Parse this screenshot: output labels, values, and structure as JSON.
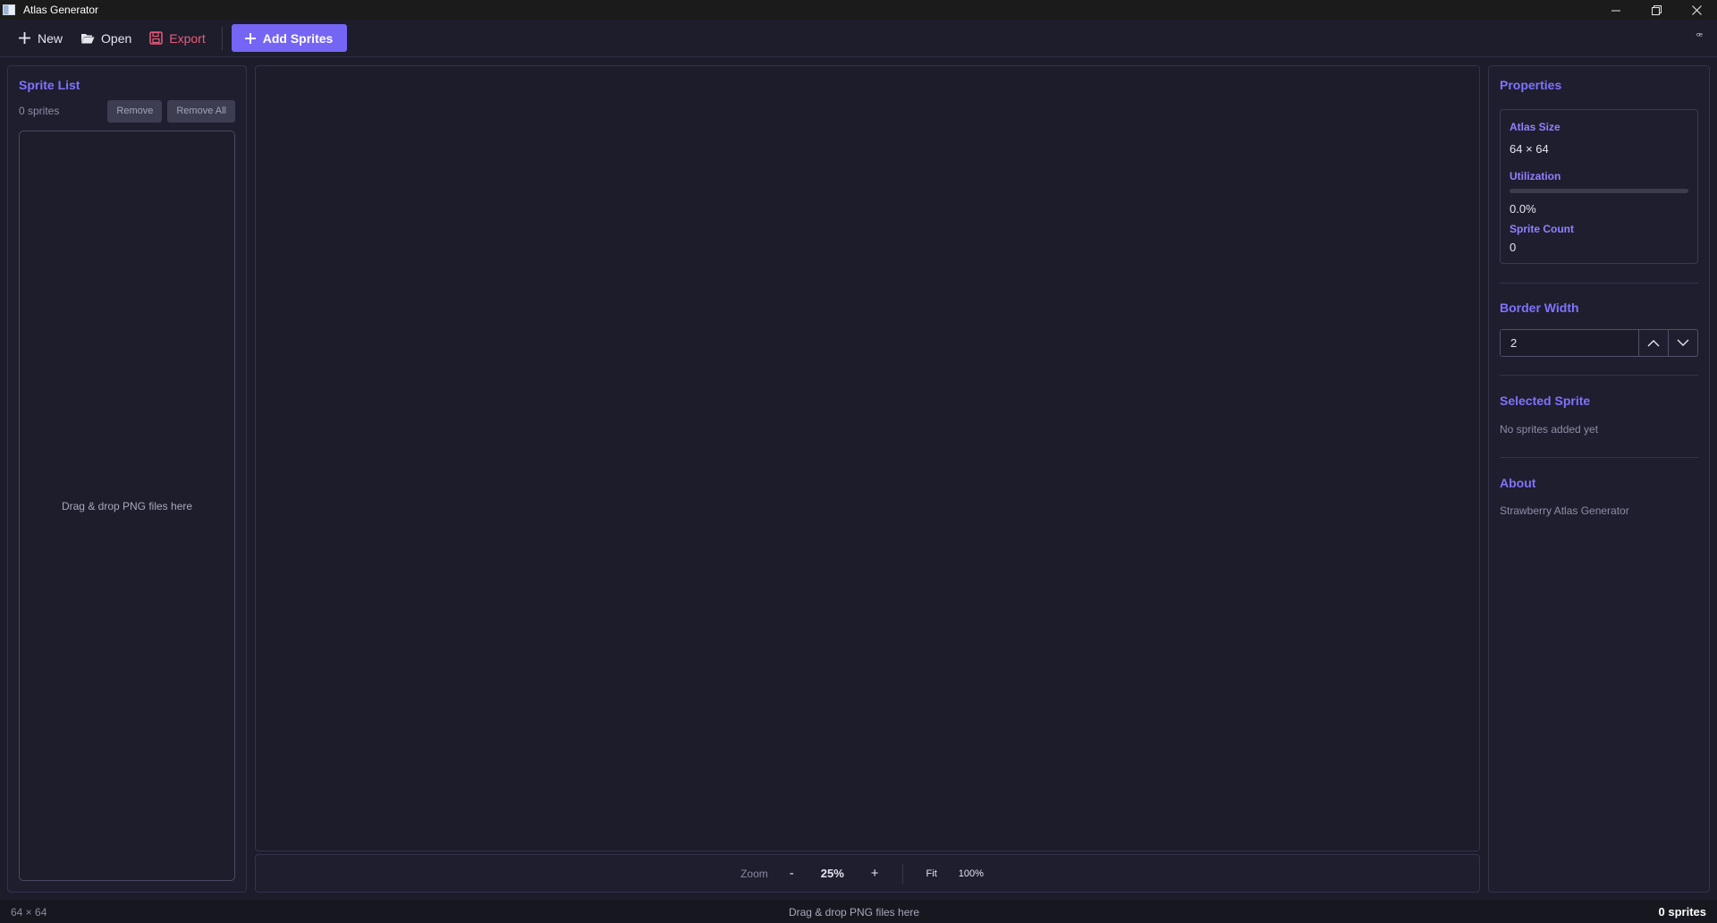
{
  "window": {
    "title": "Atlas Generator",
    "minimize_icon": "minimize-icon",
    "maximize_icon": "restore-icon",
    "close_icon": "close-icon"
  },
  "toolbar": {
    "new_label": "New",
    "open_label": "Open",
    "export_label": "Export",
    "add_sprites_label": "Add Sprites",
    "right_glyph": "ꟹ"
  },
  "sprite_list": {
    "title": "Sprite List",
    "count_text": "0 sprites",
    "remove_label": "Remove",
    "remove_all_label": "Remove All",
    "drop_text": "Drag & drop PNG files here"
  },
  "zoom": {
    "label": "Zoom",
    "minus": "-",
    "value": "25%",
    "plus": "+",
    "fit_label": "Fit",
    "actual_label": "100%"
  },
  "properties": {
    "title": "Properties",
    "atlas_size_label": "Atlas Size",
    "atlas_size_value": "64 × 64",
    "utilization_label": "Utilization",
    "utilization_fraction": 0.0,
    "utilization_value": "0.0%",
    "sprite_count_label": "Sprite Count",
    "sprite_count_value": "0",
    "border_width_title": "Border Width",
    "border_width_value": "2",
    "selected_sprite_title": "Selected Sprite",
    "selected_sprite_text": "No sprites added yet",
    "about_title": "About",
    "about_text": "Strawberry Atlas Generator"
  },
  "statusbar": {
    "left": "64 × 64",
    "center": "Drag & drop PNG files here",
    "right": "0 sprites"
  },
  "colors": {
    "accent": "#7565f5",
    "export": "#ec5b7a",
    "background": "#1c1c2b"
  }
}
